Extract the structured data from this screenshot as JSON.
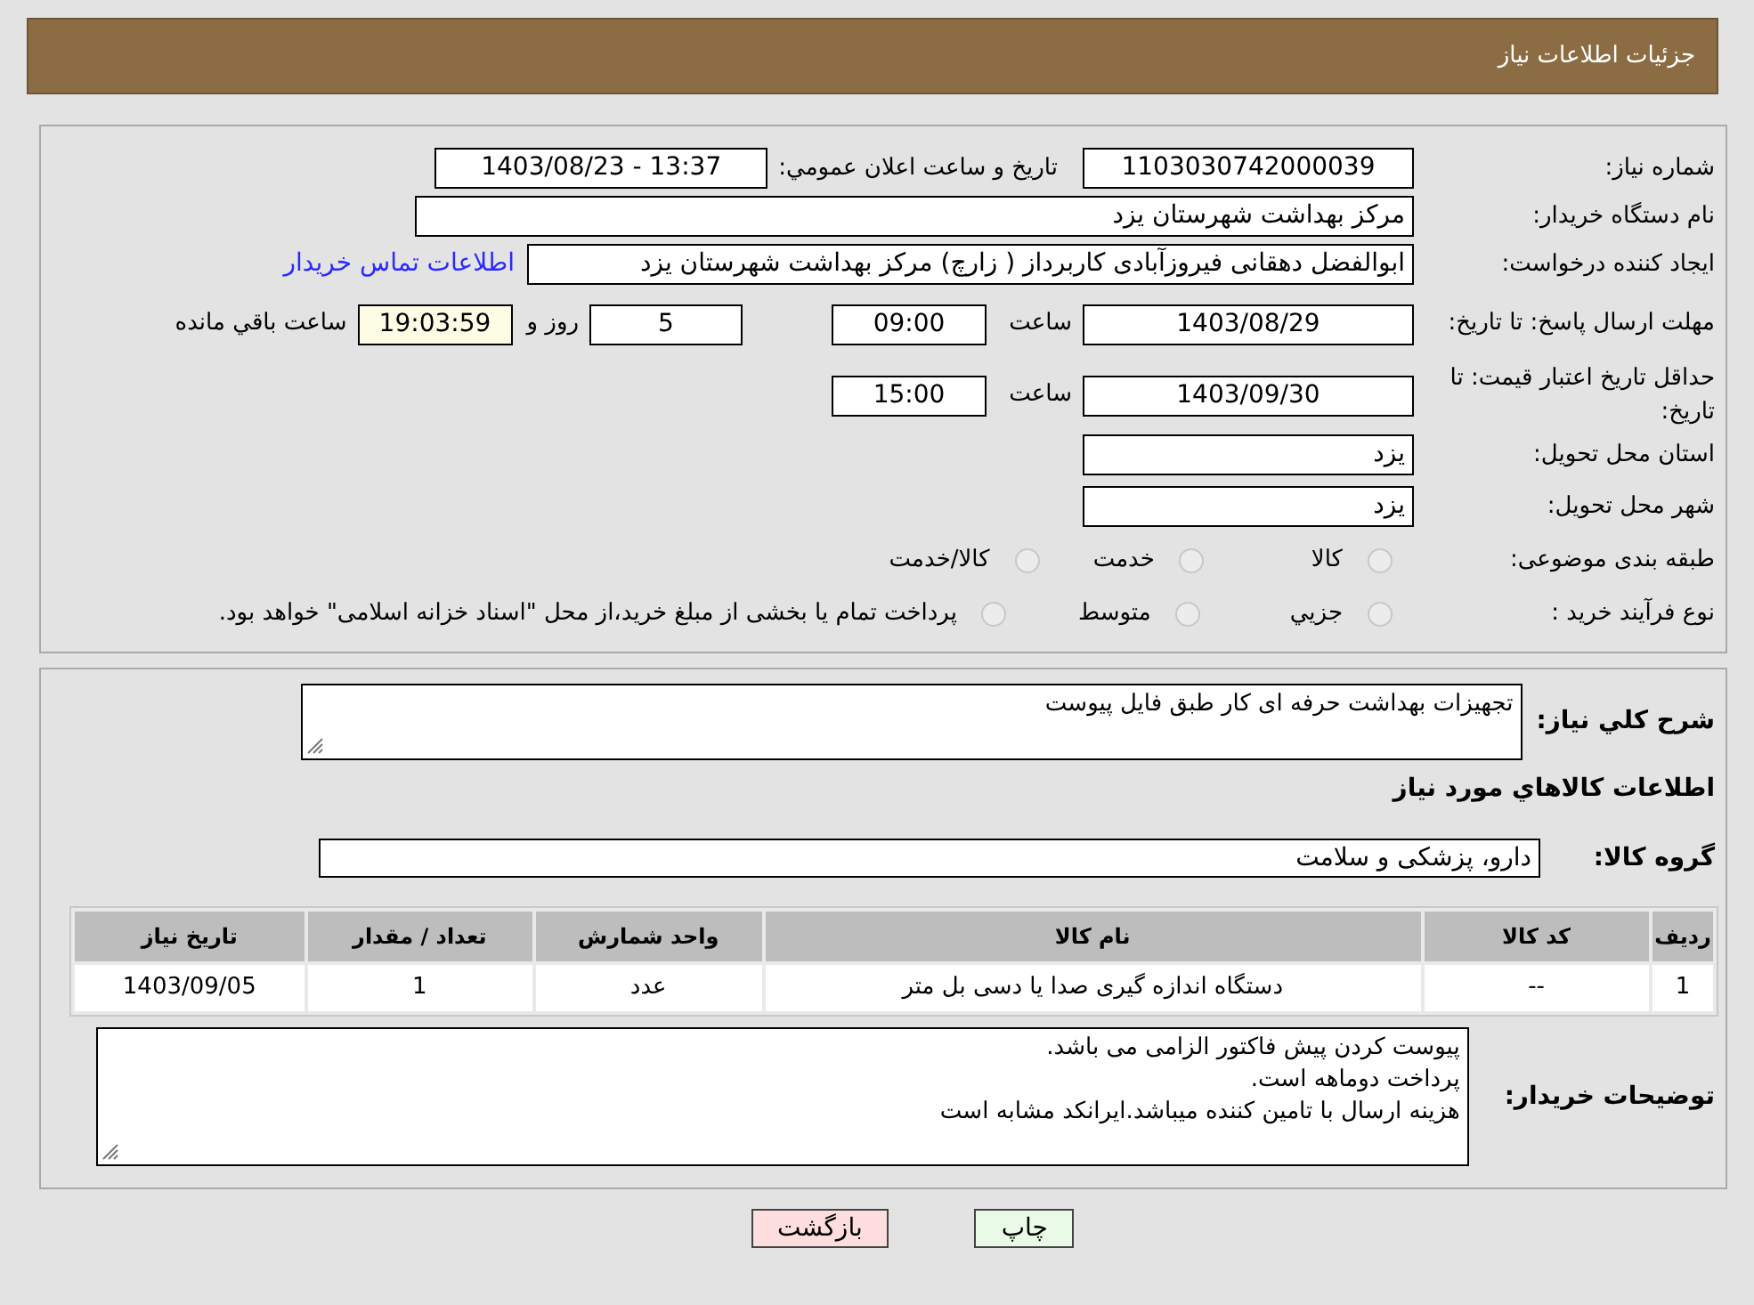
{
  "header": {
    "title": "جزئیات اطلاعات نیاز"
  },
  "details": {
    "need_number": {
      "label": "شماره نیاز:",
      "value": "1103030742000039"
    },
    "announce": {
      "label": "تاریخ و ساعت اعلان عمومي:",
      "value": "1403/08/23 - 13:37"
    },
    "buyer": {
      "label": "نام دستگاه خریدار:",
      "value": "مرکز بهداشت شهرستان یزد"
    },
    "creator": {
      "label": "ایجاد کننده درخواست:",
      "value": "ابوالفضل دهقانی فیروزآبادی کاربرداز ( زارچ) مرکز بهداشت شهرستان یزد",
      "link": "اطلاعات تماس خریدار"
    },
    "deadline": {
      "label": "مهلت ارسال پاسخ: تا تاریخ:",
      "date": "1403/08/29",
      "time_label": "ساعت",
      "time": "09:00",
      "days": "5",
      "days_label": "روز و",
      "remaining": "19:03:59",
      "remaining_label": "ساعت باقي مانده"
    },
    "validity": {
      "label": "حداقل تاریخ اعتبار قیمت: تا تاریخ:",
      "date": "1403/09/30",
      "time_label": "ساعت",
      "time": "15:00"
    },
    "province": {
      "label": "استان محل تحویل:",
      "value": "یزد"
    },
    "city": {
      "label": "شهر محل تحویل:",
      "value": "یزد"
    },
    "category": {
      "label": "طبقه بندی موضوعی:",
      "options": [
        {
          "label": "کالا",
          "selected": false
        },
        {
          "label": "خدمت",
          "selected": false
        },
        {
          "label": "کالا/خدمت",
          "selected": false
        }
      ]
    },
    "process": {
      "label": "نوع فرآیند خرید :",
      "options": [
        {
          "label": "جزيي",
          "selected": false
        },
        {
          "label": "متوسط",
          "selected": false
        },
        {
          "label": "پرداخت تمام یا بخشی از مبلغ خرید،از محل \"اسناد خزانه اسلامی\" خواهد بود.",
          "selected": false
        }
      ]
    }
  },
  "summary": {
    "label": "شرح کلي نیاز:",
    "value": "تجهیزات بهداشت حرفه ای کار طبق فایل پیوست",
    "goods_heading": "اطلاعات کالاهاي مورد نياز",
    "group_label": "گروه کالا:",
    "group": "دارو، پزشکی و سلامت"
  },
  "table": {
    "columns": [
      "ردیف",
      "کد کالا",
      "نام کالا",
      "واحد شمارش",
      "تعداد / مقدار",
      "تاریخ نیاز"
    ],
    "rows": [
      [
        "1",
        "--",
        "دستگاه اندازه گیری صدا یا دسی بل متر",
        "عدد",
        "1",
        "1403/09/05"
      ]
    ]
  },
  "notes": {
    "label": "توضیحات خریدار:",
    "lines": [
      "پیوست کردن پیش فاکتور الزامی می باشد.",
      "پرداخت دوماهه است.",
      "هزینه ارسال با تامین کننده میباشد.ایرانکد مشابه است"
    ]
  },
  "buttons": [
    {
      "label": "چاپ",
      "kind": "print"
    },
    {
      "label": "بازگشت",
      "kind": "back"
    }
  ]
}
